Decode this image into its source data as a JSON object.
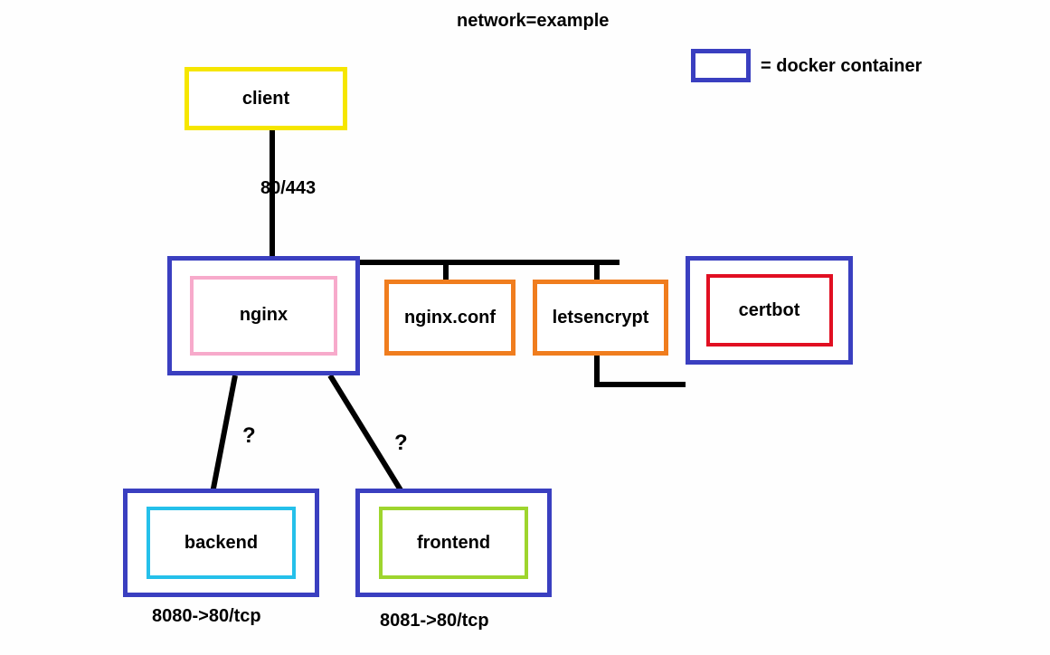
{
  "title": "network=example",
  "legend": {
    "text": "= docker container"
  },
  "nodes": {
    "client": "client",
    "nginx": "nginx",
    "nginx_conf": "nginx.conf",
    "letsencrypt": "letsencrypt",
    "certbot": "certbot",
    "backend": "backend",
    "frontend": "frontend"
  },
  "edges": {
    "client_nginx": "80/443",
    "nginx_backend": "?",
    "nginx_frontend": "?",
    "backend_ports": "8080->80/tcp",
    "frontend_ports": "8081->80/tcp"
  },
  "colors": {
    "container_border": "#3a3fc0",
    "client_border": "#f6e600",
    "nginx_inner": "#f7aacb",
    "nginx_conf_border": "#f07d1e",
    "letsencrypt_border": "#f07d1e",
    "certbot_inner": "#e10f22",
    "backend_inner": "#25c0ea",
    "frontend_inner": "#9ed52e"
  }
}
